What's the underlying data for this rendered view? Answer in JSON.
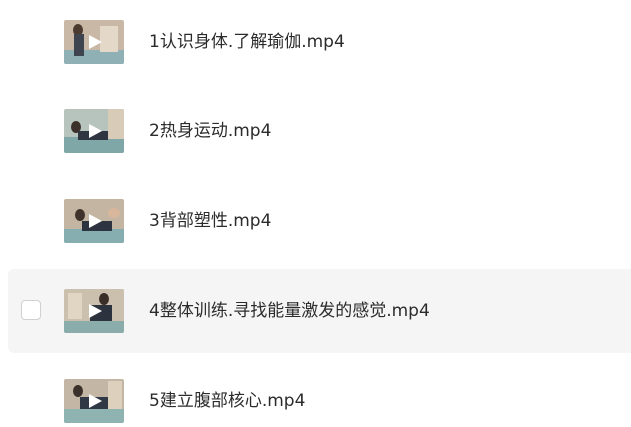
{
  "files": [
    {
      "name": "1认识身体.了解瑜伽.mp4",
      "type_icon": "video-thumbnail",
      "hovered": false
    },
    {
      "name": "2热身运动.mp4",
      "type_icon": "video-thumbnail",
      "hovered": false
    },
    {
      "name": "3背部塑性.mp4",
      "type_icon": "video-thumbnail",
      "hovered": false
    },
    {
      "name": "4整体训练.寻找能量激发的感觉.mp4",
      "type_icon": "video-thumbnail",
      "hovered": true
    },
    {
      "name": "5建立腹部核心.mp4",
      "type_icon": "video-thumbnail",
      "hovered": false
    }
  ],
  "colors": {
    "text": "#2b2b2b",
    "hover_background": "#f5f5f5",
    "checkbox_border": "#d0d0d0",
    "play_icon": "#ffffff"
  }
}
